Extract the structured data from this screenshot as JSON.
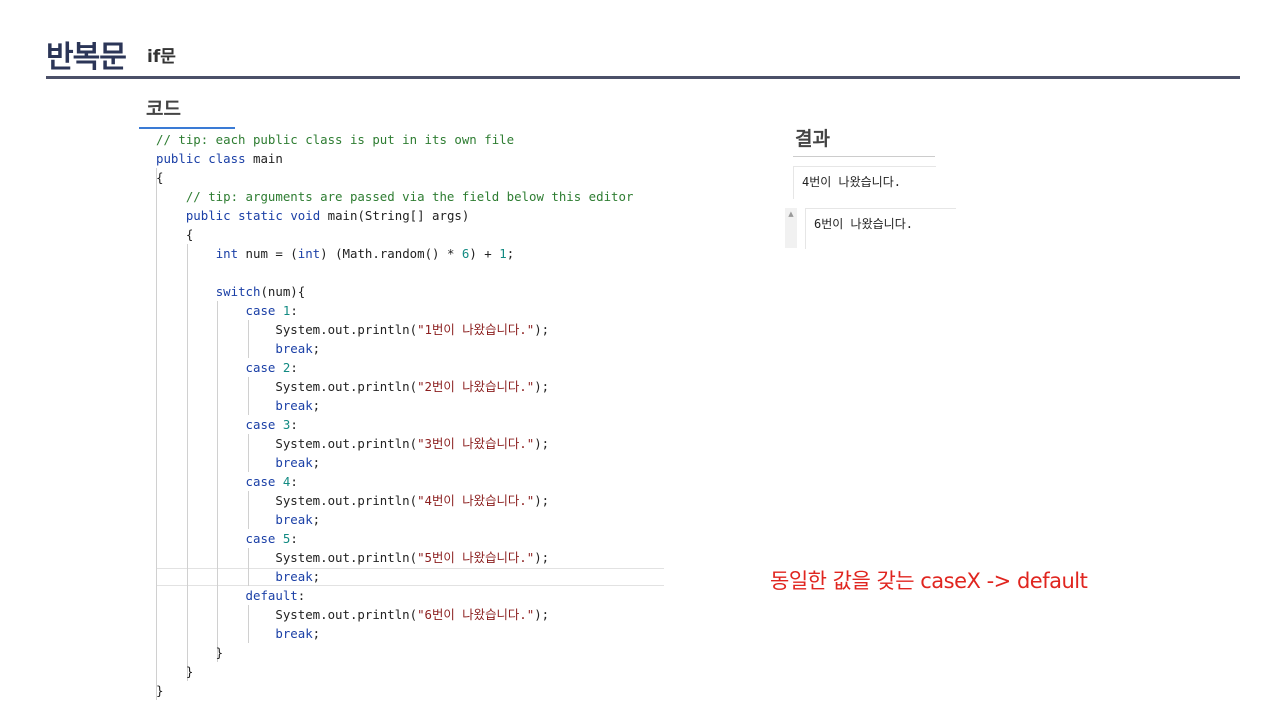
{
  "header": {
    "title": "반복문",
    "subtitle": "if문"
  },
  "code_section": {
    "heading": "코드",
    "lines": [
      [
        {
          "t": "// tip: each public class is put in its own file",
          "c": "comment"
        }
      ],
      [
        {
          "t": "public",
          "c": "kw"
        },
        {
          "t": " "
        },
        {
          "t": "class",
          "c": "kw"
        },
        {
          "t": " main"
        }
      ],
      [
        {
          "t": "{"
        }
      ],
      [
        {
          "t": "    "
        },
        {
          "t": "// tip: arguments are passed via the field below this editor",
          "c": "comment"
        }
      ],
      [
        {
          "t": "    "
        },
        {
          "t": "public",
          "c": "kw"
        },
        {
          "t": " "
        },
        {
          "t": "static",
          "c": "kw"
        },
        {
          "t": " "
        },
        {
          "t": "void",
          "c": "kw"
        },
        {
          "t": " main(String[] args)"
        }
      ],
      [
        {
          "t": "    {"
        }
      ],
      [
        {
          "t": "        "
        },
        {
          "t": "int",
          "c": "kw"
        },
        {
          "t": " num = ("
        },
        {
          "t": "int",
          "c": "kw"
        },
        {
          "t": ") (Math.random() * "
        },
        {
          "t": "6",
          "c": "num"
        },
        {
          "t": ") + "
        },
        {
          "t": "1",
          "c": "num"
        },
        {
          "t": ";"
        }
      ],
      [],
      [
        {
          "t": "        "
        },
        {
          "t": "switch",
          "c": "kw"
        },
        {
          "t": "(num){"
        }
      ],
      [
        {
          "t": "            "
        },
        {
          "t": "case",
          "c": "kw"
        },
        {
          "t": " "
        },
        {
          "t": "1",
          "c": "num"
        },
        {
          "t": ":"
        }
      ],
      [
        {
          "t": "                System.out.println("
        },
        {
          "t": "\"1번이 나왔습니다.\"",
          "c": "str"
        },
        {
          "t": ");"
        }
      ],
      [
        {
          "t": "                "
        },
        {
          "t": "break",
          "c": "kw"
        },
        {
          "t": ";"
        }
      ],
      [
        {
          "t": "            "
        },
        {
          "t": "case",
          "c": "kw"
        },
        {
          "t": " "
        },
        {
          "t": "2",
          "c": "num"
        },
        {
          "t": ":"
        }
      ],
      [
        {
          "t": "                System.out.println("
        },
        {
          "t": "\"2번이 나왔습니다.\"",
          "c": "str"
        },
        {
          "t": ");"
        }
      ],
      [
        {
          "t": "                "
        },
        {
          "t": "break",
          "c": "kw"
        },
        {
          "t": ";"
        }
      ],
      [
        {
          "t": "            "
        },
        {
          "t": "case",
          "c": "kw"
        },
        {
          "t": " "
        },
        {
          "t": "3",
          "c": "num"
        },
        {
          "t": ":"
        }
      ],
      [
        {
          "t": "                System.out.println("
        },
        {
          "t": "\"3번이 나왔습니다.\"",
          "c": "str"
        },
        {
          "t": ");"
        }
      ],
      [
        {
          "t": "                "
        },
        {
          "t": "break",
          "c": "kw"
        },
        {
          "t": ";"
        }
      ],
      [
        {
          "t": "            "
        },
        {
          "t": "case",
          "c": "kw"
        },
        {
          "t": " "
        },
        {
          "t": "4",
          "c": "num"
        },
        {
          "t": ":"
        }
      ],
      [
        {
          "t": "                System.out.println("
        },
        {
          "t": "\"4번이 나왔습니다.\"",
          "c": "str"
        },
        {
          "t": ");"
        }
      ],
      [
        {
          "t": "                "
        },
        {
          "t": "break",
          "c": "kw"
        },
        {
          "t": ";"
        }
      ],
      [
        {
          "t": "            "
        },
        {
          "t": "case",
          "c": "kw"
        },
        {
          "t": " "
        },
        {
          "t": "5",
          "c": "num"
        },
        {
          "t": ":"
        }
      ],
      [
        {
          "t": "                System.out.println("
        },
        {
          "t": "\"5번이 나왔습니다.\"",
          "c": "str"
        },
        {
          "t": ");"
        }
      ],
      [
        {
          "t": "                "
        },
        {
          "t": "break",
          "c": "kw"
        },
        {
          "t": ";"
        }
      ],
      [
        {
          "t": "            "
        },
        {
          "t": "default",
          "c": "kw"
        },
        {
          "t": ":"
        }
      ],
      [
        {
          "t": "                System.out.println("
        },
        {
          "t": "\"6번이 나왔습니다.\"",
          "c": "str"
        },
        {
          "t": ");"
        }
      ],
      [
        {
          "t": "                "
        },
        {
          "t": "break",
          "c": "kw"
        },
        {
          "t": ";"
        }
      ],
      [
        {
          "t": "        }"
        }
      ],
      [
        {
          "t": "    }"
        }
      ],
      [
        {
          "t": "}"
        }
      ]
    ]
  },
  "result_section": {
    "heading": "결과",
    "outputs": [
      "4번이 나왔습니다.",
      "6번이 나왔습니다."
    ]
  },
  "note": "동일한 값을 갖는 caseX -> default",
  "colors": {
    "title": "#2b3557",
    "keyword": "#1a3fa6",
    "comment": "#2e7d32",
    "number": "#128a82",
    "string": "#8b1e1e",
    "note": "#e0251f"
  }
}
